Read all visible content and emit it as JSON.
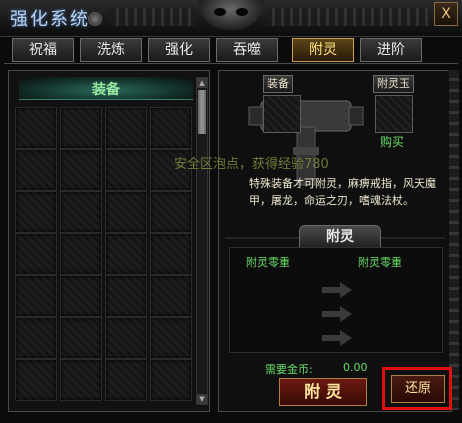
{
  "window": {
    "title": "强化系统",
    "close_glyph": "X"
  },
  "tabs": [
    {
      "label": "祝福",
      "active": false
    },
    {
      "label": "洗炼",
      "active": false
    },
    {
      "label": "强化",
      "active": false
    },
    {
      "label": "吞噬",
      "active": false
    },
    {
      "label": "附灵",
      "active": true
    },
    {
      "label": "进阶",
      "active": false
    }
  ],
  "equipment": {
    "header": "装备",
    "rows": 7,
    "cols": 4
  },
  "enchant": {
    "equip_slot_label": "装备",
    "jade_slot_label": "附灵玉",
    "buy_label": "购买",
    "floating_message": "安全区泡点，获得经验780",
    "description": "特殊装备才可附灵，麻痹戒指，风天魔甲，屠龙，命运之刃，嗜魂法杖。",
    "section_title": "附灵",
    "result_left": "附灵零重",
    "result_right": "附灵零重",
    "gold_label": "需要金币:",
    "gold_value": "0.00",
    "enchant_button": "附 灵",
    "restore_button": "还原"
  },
  "colors": {
    "accent_green": "#6adc6a",
    "gold_text": "#ffe080",
    "highlight_red": "#e01010"
  }
}
